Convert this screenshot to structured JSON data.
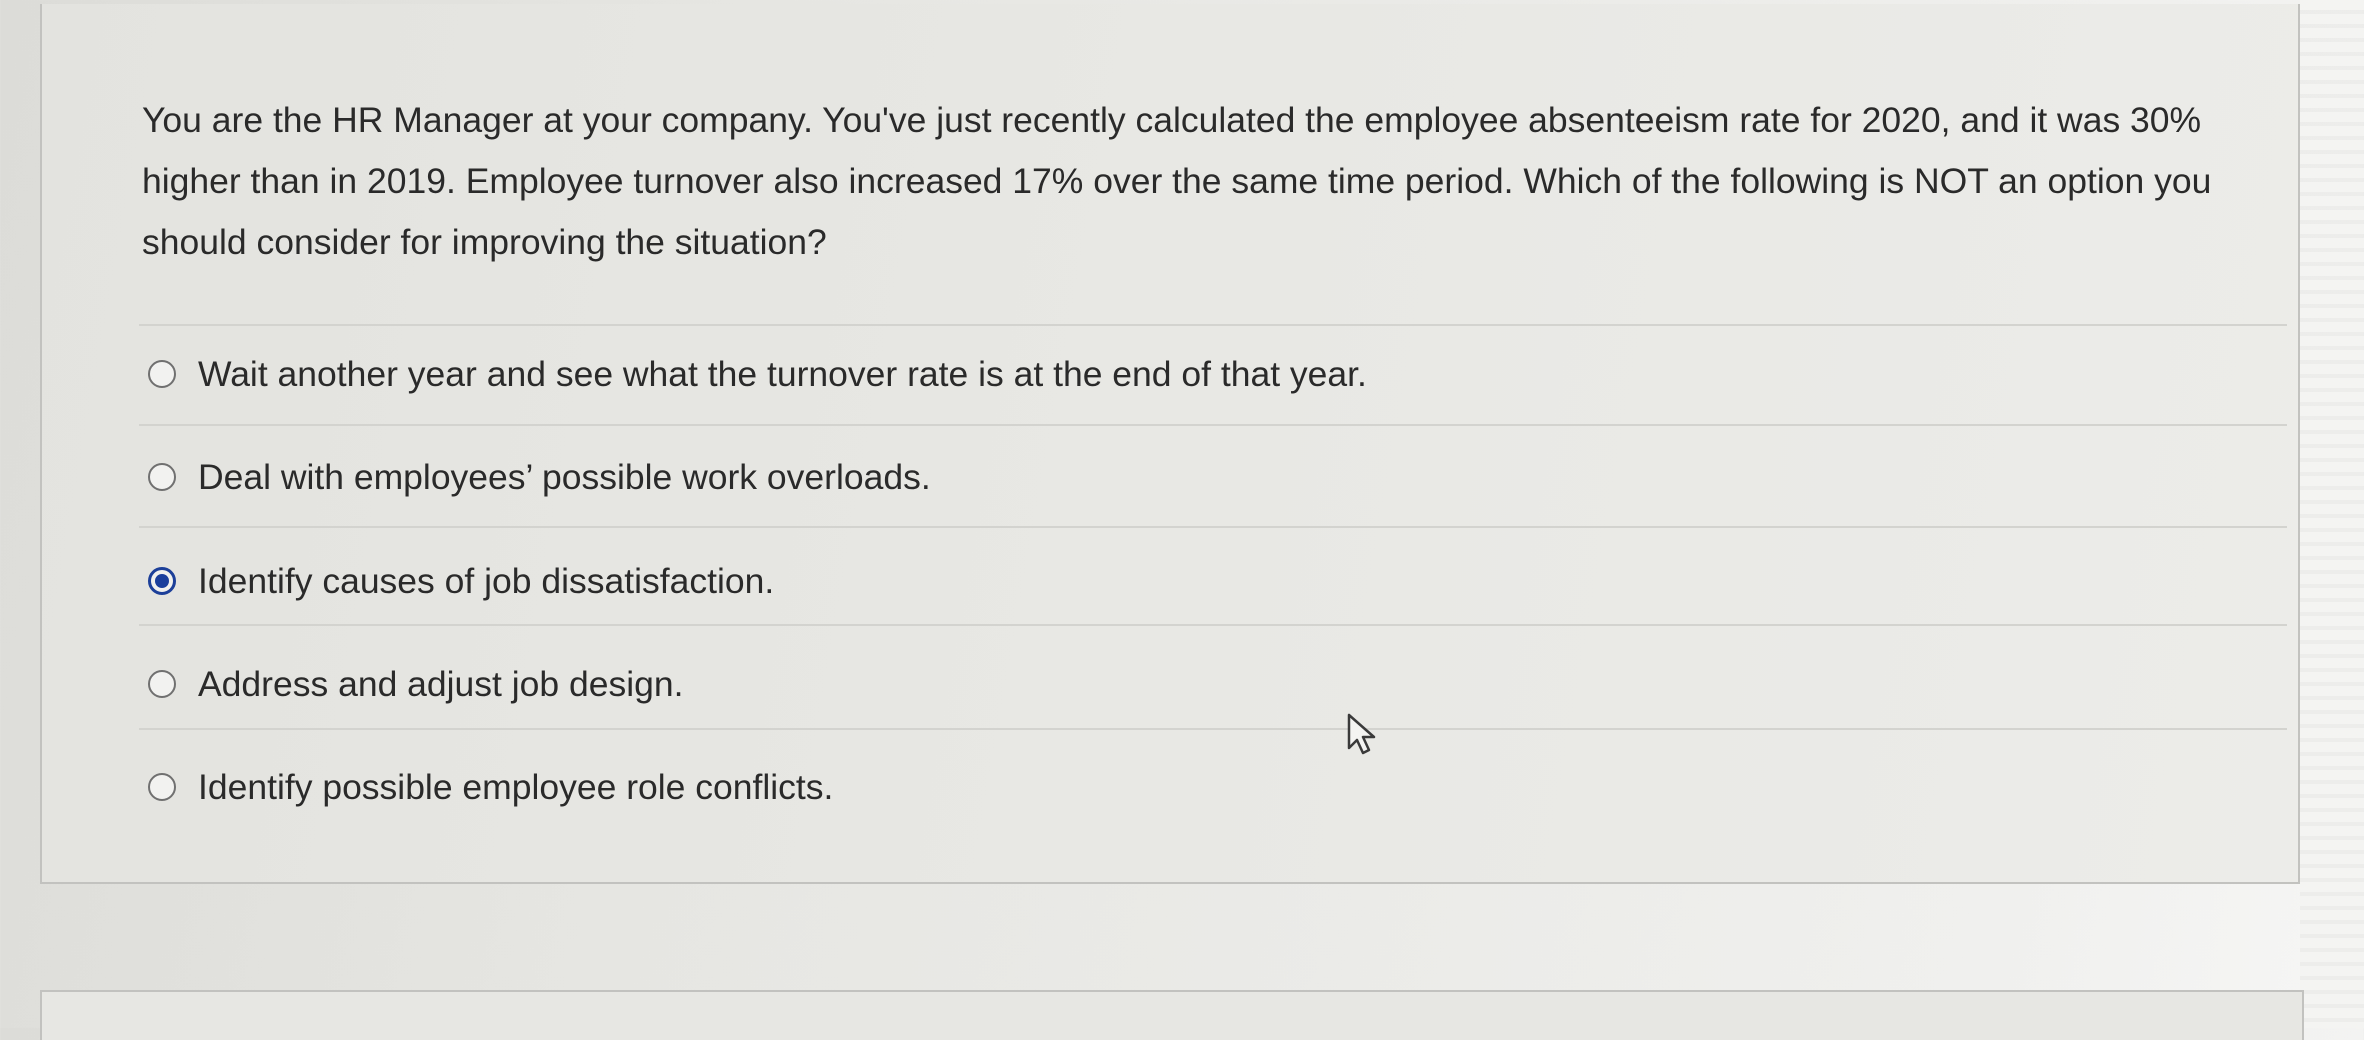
{
  "question": {
    "text": "You are the HR Manager at your company.  You've just recently calculated the employee absenteeism rate for 2020, and it was 30% higher than in 2019.  Employee turnover also increased 17% over the same time period.  Which of the following is NOT an option you should consider for improving the situation?"
  },
  "options": [
    {
      "label": "Wait another year and see what the turnover rate is at the end of that year.",
      "selected": false
    },
    {
      "label": "Deal with employees’ possible work overloads.",
      "selected": false
    },
    {
      "label": "Identify causes of job dissatisfaction.",
      "selected": true
    },
    {
      "label": "Address and adjust job design.",
      "selected": false
    },
    {
      "label": "Identify possible employee role conflicts.",
      "selected": false
    }
  ],
  "colors": {
    "radio_selected": "#1a3e9c",
    "text": "#2a2a2a"
  },
  "icons": {
    "cursor": "hand-pointer-icon"
  }
}
